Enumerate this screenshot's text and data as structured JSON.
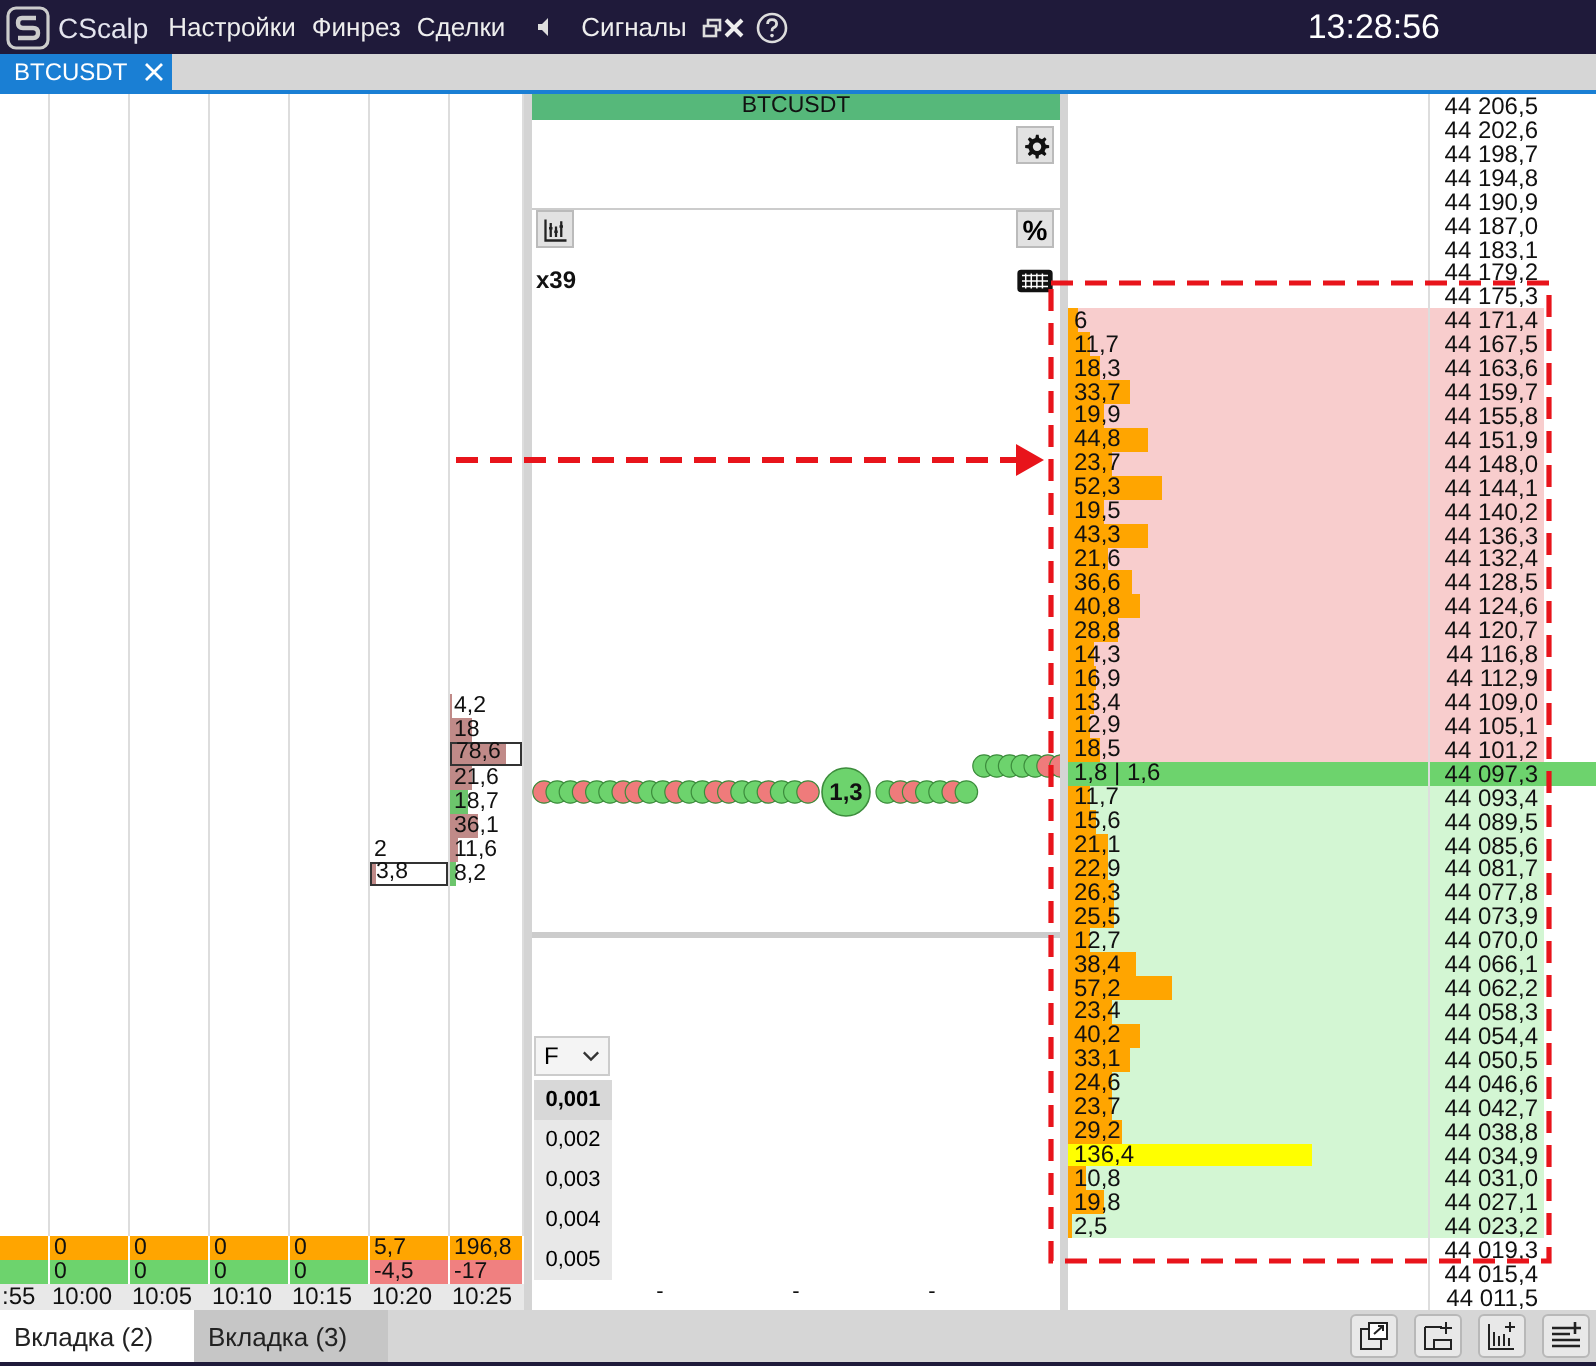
{
  "title_bar": {
    "app_name": "CScalp",
    "menu": [
      "Настройки",
      "Финрез",
      "Сделки"
    ],
    "signals": "Сигналы",
    "clock": "13:28:56"
  },
  "instrument_tabs": [
    {
      "label": "BTCUSDT",
      "selected": true
    }
  ],
  "cluster_panel": {
    "columns": [
      {
        "time": ":55",
        "color": "#6dd36d"
      },
      {
        "time": "10:00",
        "total": "0",
        "delta": "0",
        "color": "#6dd36d"
      },
      {
        "time": "10:05",
        "total": "0",
        "delta": "0",
        "color": "#6dd36d"
      },
      {
        "time": "10:10",
        "total": "0",
        "delta": "0",
        "color": "#6dd36d"
      },
      {
        "time": "10:15",
        "total": "0",
        "delta": "0",
        "color": "#6dd36d"
      },
      {
        "time": "10:20",
        "total": "5,7",
        "delta": "-4,5",
        "color": "#f08080",
        "cells": [
          {
            "value": "2",
            "boxed": false
          },
          {
            "value": "3,8",
            "level": 0.05,
            "color": "#c08a88",
            "boxed": true
          }
        ]
      },
      {
        "time": "10:25",
        "total": "196,8",
        "delta": "-17",
        "color": "#f08080",
        "cells": [
          {
            "value": "4,2",
            "level": 0.04,
            "color": "#c08a88",
            "boxed": false
          },
          {
            "value": "18",
            "level": 0.3,
            "color": "#c08a88",
            "boxed": false
          },
          {
            "value": "78,6",
            "level": 0.78,
            "color": "#c08a88",
            "boxed": true
          },
          {
            "value": "21,6",
            "level": 0.3,
            "color": "#c08a88",
            "boxed": false
          },
          {
            "value": "18,7",
            "level": 0.25,
            "color": "#6cc56c",
            "boxed": false
          },
          {
            "value": "36,1",
            "level": 0.4,
            "color": "#c08a88",
            "boxed": false
          },
          {
            "value": "11,6",
            "level": 0.1,
            "color": "#c08a88",
            "boxed": false
          },
          {
            "value": "8,2",
            "level": 0.08,
            "color": "#6cc56c",
            "boxed": false
          }
        ]
      }
    ]
  },
  "chart_panel": {
    "header": "BTCUSDT",
    "percent_button": "%",
    "multiplier": "x39",
    "trade_label": "1,3",
    "filter": "F",
    "scale": [
      {
        "label": "0,001",
        "selected": true
      },
      {
        "label": "0,002",
        "selected": false
      },
      {
        "label": "0,003",
        "selected": false
      },
      {
        "label": "0,004",
        "selected": false
      },
      {
        "label": "0,005",
        "selected": false
      }
    ],
    "axis_marks": [
      "-",
      "-",
      "-"
    ]
  },
  "order_book": {
    "rows": [
      {
        "price": "44 206,5",
        "kind": "empty"
      },
      {
        "price": "44 202,6",
        "kind": "empty"
      },
      {
        "price": "44 198,7",
        "kind": "empty"
      },
      {
        "price": "44 194,8",
        "kind": "empty"
      },
      {
        "price": "44 190,9",
        "kind": "empty"
      },
      {
        "price": "44 187,0",
        "kind": "empty"
      },
      {
        "price": "44 183,1",
        "kind": "empty"
      },
      {
        "price": "44 179,2",
        "kind": "empty"
      },
      {
        "price": "44 175,3",
        "kind": "empty"
      },
      {
        "price": "44 171,4",
        "volume": "6",
        "level": 0.03,
        "kind": "ask",
        "color": "#ffa500"
      },
      {
        "price": "44 167,5",
        "volume": "11,7",
        "level": 0.06,
        "kind": "ask",
        "color": "#ffa500"
      },
      {
        "price": "44 163,6",
        "volume": "18,3",
        "level": 0.09,
        "kind": "ask",
        "color": "#ffa500"
      },
      {
        "price": "44 159,7",
        "volume": "33,7",
        "level": 0.17,
        "kind": "ask",
        "color": "#ffa500"
      },
      {
        "price": "44 155,8",
        "volume": "19,9",
        "level": 0.1,
        "kind": "ask",
        "color": "#ffa500"
      },
      {
        "price": "44 151,9",
        "volume": "44,8",
        "level": 0.22,
        "kind": "ask",
        "color": "#ffa500"
      },
      {
        "price": "44 148,0",
        "volume": "23,7",
        "level": 0.12,
        "kind": "ask",
        "color": "#ffa500"
      },
      {
        "price": "44 144,1",
        "volume": "52,3",
        "level": 0.26,
        "kind": "ask",
        "color": "#ffa500"
      },
      {
        "price": "44 140,2",
        "volume": "19,5",
        "level": 0.1,
        "kind": "ask",
        "color": "#ffa500"
      },
      {
        "price": "44 136,3",
        "volume": "43,3",
        "level": 0.22,
        "kind": "ask",
        "color": "#ffa500"
      },
      {
        "price": "44 132,4",
        "volume": "21,6",
        "level": 0.11,
        "kind": "ask",
        "color": "#ffa500"
      },
      {
        "price": "44 128,5",
        "volume": "36,6",
        "level": 0.18,
        "kind": "ask",
        "color": "#ffa500"
      },
      {
        "price": "44 124,6",
        "volume": "40,8",
        "level": 0.2,
        "kind": "ask",
        "color": "#ffa500"
      },
      {
        "price": "44 120,7",
        "volume": "28,8",
        "level": 0.14,
        "kind": "ask",
        "color": "#ffa500"
      },
      {
        "price": "44 116,8",
        "volume": "14,3",
        "level": 0.07,
        "kind": "ask",
        "color": "#ffa500"
      },
      {
        "price": "44 112,9",
        "volume": "16,9",
        "level": 0.08,
        "kind": "ask",
        "color": "#ffa500"
      },
      {
        "price": "44 109,0",
        "volume": "13,4",
        "level": 0.07,
        "kind": "ask",
        "color": "#ffa500"
      },
      {
        "price": "44 105,1",
        "volume": "12,9",
        "level": 0.06,
        "kind": "ask",
        "color": "#ffa500"
      },
      {
        "price": "44 101,2",
        "volume": "18,5",
        "level": 0.09,
        "kind": "ask",
        "color": "#ffa500"
      },
      {
        "price": "44 097,3",
        "volume": "1,8 | 1,6",
        "kind": "spread"
      },
      {
        "price": "44 093,4",
        "volume": "11,7",
        "level": 0.06,
        "kind": "bid",
        "color": "#ffa500"
      },
      {
        "price": "44 089,5",
        "volume": "15,6",
        "level": 0.08,
        "kind": "bid",
        "color": "#ffa500"
      },
      {
        "price": "44 085,6",
        "volume": "21,1",
        "level": 0.11,
        "kind": "bid",
        "color": "#ffa500"
      },
      {
        "price": "44 081,7",
        "volume": "22,9",
        "level": 0.11,
        "kind": "bid",
        "color": "#ffa500"
      },
      {
        "price": "44 077,8",
        "volume": "26,3",
        "level": 0.13,
        "kind": "bid",
        "color": "#ffa500"
      },
      {
        "price": "44 073,9",
        "volume": "25,5",
        "level": 0.13,
        "kind": "bid",
        "color": "#ffa500"
      },
      {
        "price": "44 070,0",
        "volume": "12,7",
        "level": 0.06,
        "kind": "bid",
        "color": "#ffa500"
      },
      {
        "price": "44 066,1",
        "volume": "38,4",
        "level": 0.19,
        "kind": "bid",
        "color": "#ffa500"
      },
      {
        "price": "44 062,2",
        "volume": "57,2",
        "level": 0.29,
        "kind": "bid",
        "color": "#ffa500"
      },
      {
        "price": "44 058,3",
        "volume": "23,4",
        "level": 0.12,
        "kind": "bid",
        "color": "#ffa500"
      },
      {
        "price": "44 054,4",
        "volume": "40,2",
        "level": 0.2,
        "kind": "bid",
        "color": "#ffa500"
      },
      {
        "price": "44 050,5",
        "volume": "33,1",
        "level": 0.17,
        "kind": "bid",
        "color": "#ffa500"
      },
      {
        "price": "44 046,6",
        "volume": "24,6",
        "level": 0.12,
        "kind": "bid",
        "color": "#ffa500"
      },
      {
        "price": "44 042,7",
        "volume": "23,7",
        "level": 0.12,
        "kind": "bid",
        "color": "#ffa500"
      },
      {
        "price": "44 038,8",
        "volume": "29,2",
        "level": 0.15,
        "kind": "bid",
        "color": "#ffa500"
      },
      {
        "price": "44 034,9",
        "volume": "136,4",
        "level": 0.68,
        "kind": "bid",
        "color": "#ffff00"
      },
      {
        "price": "44 031,0",
        "volume": "10,8",
        "level": 0.05,
        "kind": "bid",
        "color": "#ffa500"
      },
      {
        "price": "44 027,1",
        "volume": "19,8",
        "level": 0.1,
        "kind": "bid",
        "color": "#ffa500"
      },
      {
        "price": "44 023,2",
        "volume": "2,5",
        "level": 0.01,
        "kind": "bid",
        "color": "#ffa500"
      },
      {
        "price": "44 019,3",
        "kind": "empty"
      },
      {
        "price": "44 015,4",
        "kind": "empty"
      },
      {
        "price": "44 011,5",
        "kind": "empty"
      }
    ]
  },
  "workspace_tabs": [
    {
      "label": "Вкладка (2)",
      "selected": true
    },
    {
      "label": "Вкладка (3)",
      "selected": false
    }
  ]
}
